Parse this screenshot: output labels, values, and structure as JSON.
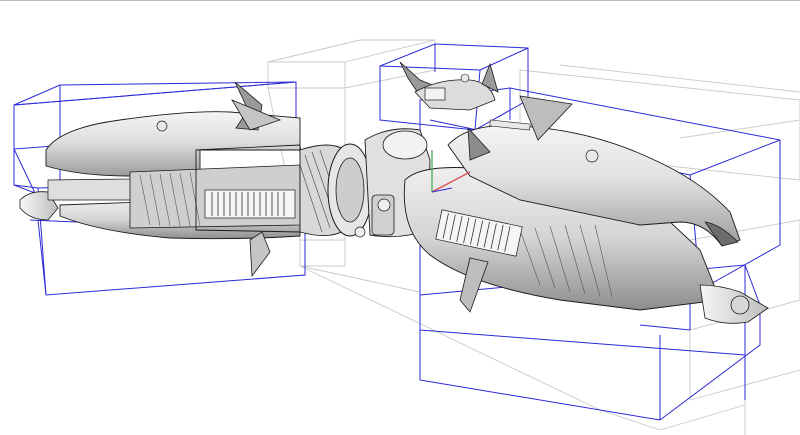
{
  "viewport": {
    "colors": {
      "background": "#ffffff",
      "selection_box": "#2b2bd8",
      "bounding_box": "#c8c8c8",
      "model_fill": "#e2e2e2",
      "model_shade": "#a9a9a9",
      "model_edge": "#1a1a1a",
      "axis_x": "#d9534f",
      "axis_y": "#4caf50"
    }
  }
}
